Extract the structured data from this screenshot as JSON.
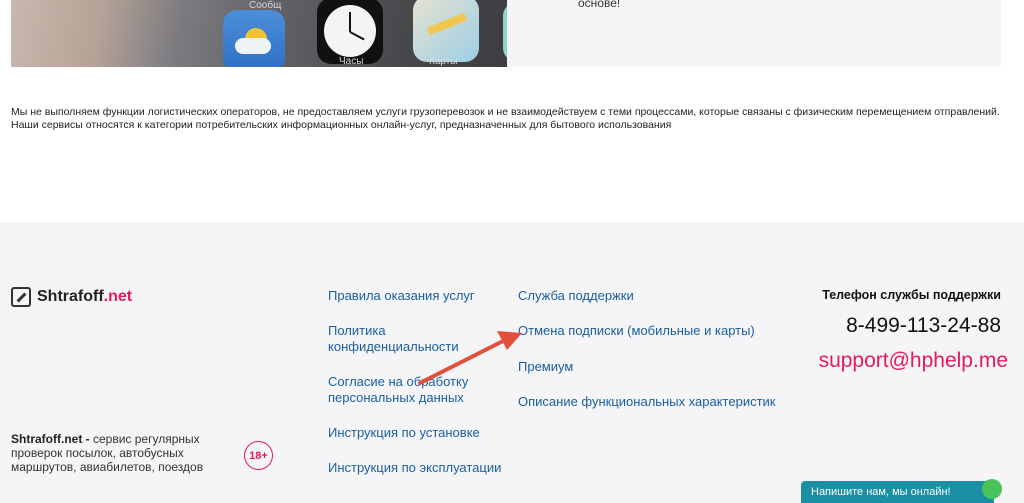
{
  "top": {
    "snippet_text": "основе!",
    "app_labels": [
      "Сообщ",
      "Часы",
      "Карты"
    ]
  },
  "disclaimer": "Мы не выполняем функции логистических операторов, не предоставляем услуги грузоперевозок и не взаимодействуем с теми процессами, которые связаны с физическим перемещением отправлений. Наши сервисы относятся к категории потребительских информационных онлайн-услуг, предназначенных для бытового использования",
  "footer": {
    "logo": {
      "name": "Shtrafoff",
      "suffix": ".net"
    },
    "about": {
      "brand": "Shtrafoff.net -",
      "text": "сервис регулярных проверок посылок, автобусных маршрутов, авиабилетов, поездов"
    },
    "age_badge": "18+",
    "col1_links": [
      "Правила оказания услуг",
      "Политика конфиденциальности",
      "Согласие на обработку персональных данных",
      "Инструкция по установке",
      "Инструкция по эксплуатации"
    ],
    "col2_links": [
      "Служба поддержки",
      "Отмена подписки (мобильные и карты)",
      "Премиум",
      "Описание функциональных характеристик"
    ],
    "support": {
      "label": "Телефон службы поддержки",
      "phone": "8-499-113-24-88",
      "email": "support@hphelp.me"
    }
  },
  "chat_widget": {
    "label": "Напишите нам, мы онлайн!"
  },
  "colors": {
    "accent": "#e8195a",
    "link": "#1a5fa0",
    "footer_bg": "#f5f5f7",
    "arrow": "#e0503a",
    "chat": "#1b8fa3"
  }
}
